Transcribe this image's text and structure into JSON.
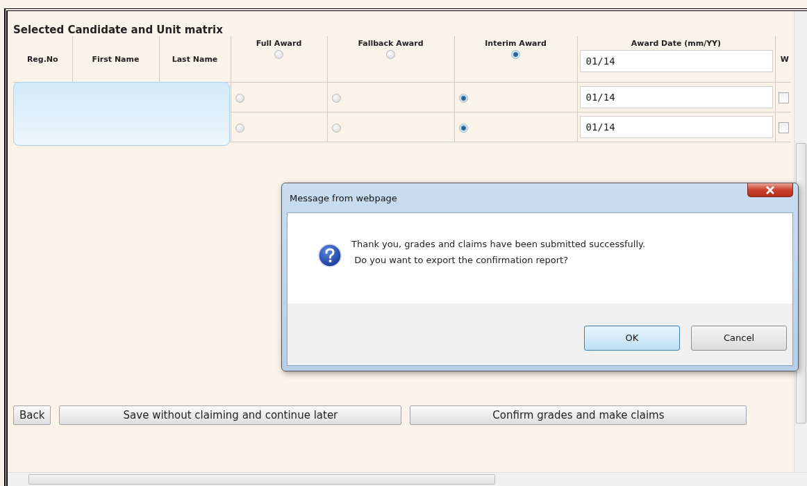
{
  "title": "Selected Candidate and Unit matrix",
  "columns": [
    "Reg.No",
    "First Name",
    "Last Name",
    "Full Award",
    "Fallback Award",
    "Interim Award",
    "Award Date (mm/YY)",
    "W"
  ],
  "header_controls": {
    "awards": [
      {
        "selected": false
      },
      {
        "selected": false
      },
      {
        "selected": true
      }
    ],
    "date": "01/14"
  },
  "rows": [
    {
      "awards": [
        {
          "selected": false
        },
        {
          "selected": false
        },
        {
          "selected": true
        }
      ],
      "date": "01/14",
      "checked": false
    },
    {
      "awards": [
        {
          "selected": false
        },
        {
          "selected": false
        },
        {
          "selected": true
        }
      ],
      "date": "01/14",
      "checked": false
    }
  ],
  "buttons": [
    {
      "label": "Back"
    },
    {
      "label": "Save without claiming and continue later"
    },
    {
      "label": "Confirm grades and make claims"
    }
  ],
  "dialog": {
    "title": "Message from webpage",
    "message": [
      "Thank you, grades and claims have been submitted successfully.",
      " Do you want to export the confirmation report?"
    ],
    "buttons": [
      {
        "label": "OK",
        "default": true
      },
      {
        "label": "Cancel",
        "default": false
      }
    ]
  }
}
